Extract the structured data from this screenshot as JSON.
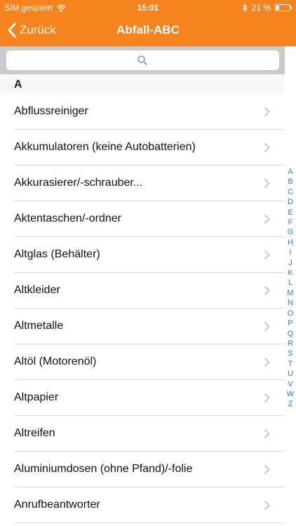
{
  "status": {
    "carrier": "SIM gesperrt",
    "time": "15:01",
    "battery_text": "21 %",
    "battery_level": 0.21,
    "icons": [
      "wifi-icon",
      "bluetooth-icon",
      "battery-icon"
    ]
  },
  "navbar": {
    "back_label": "Zurück",
    "title": "Abfall-ABC",
    "color": "#f5841f"
  },
  "search": {
    "placeholder": "",
    "value": ""
  },
  "section": {
    "title": "A"
  },
  "items": [
    {
      "label": "Abflussreiniger"
    },
    {
      "label": "Akkumulatoren (keine Autobatterien)"
    },
    {
      "label": "Akkurasierer/-schrauber..."
    },
    {
      "label": "Aktentaschen/-ordner"
    },
    {
      "label": "Altglas (Behälter)"
    },
    {
      "label": "Altkleider"
    },
    {
      "label": "Altmetalle"
    },
    {
      "label": "Altöl (Motorenöl)"
    },
    {
      "label": "Altpapier"
    },
    {
      "label": "Altreifen"
    },
    {
      "label": "Aluminiumdosen (ohne Pfand)/-folie"
    },
    {
      "label": "Anrufbeantworter"
    }
  ],
  "index_letters": [
    "A",
    "B",
    "C",
    "D",
    "E",
    "F",
    "G",
    "H",
    "I",
    "J",
    "K",
    "L",
    "M",
    "N",
    "O",
    "P",
    "Q",
    "R",
    "S",
    "T",
    "U",
    "V",
    "W",
    "Z"
  ]
}
